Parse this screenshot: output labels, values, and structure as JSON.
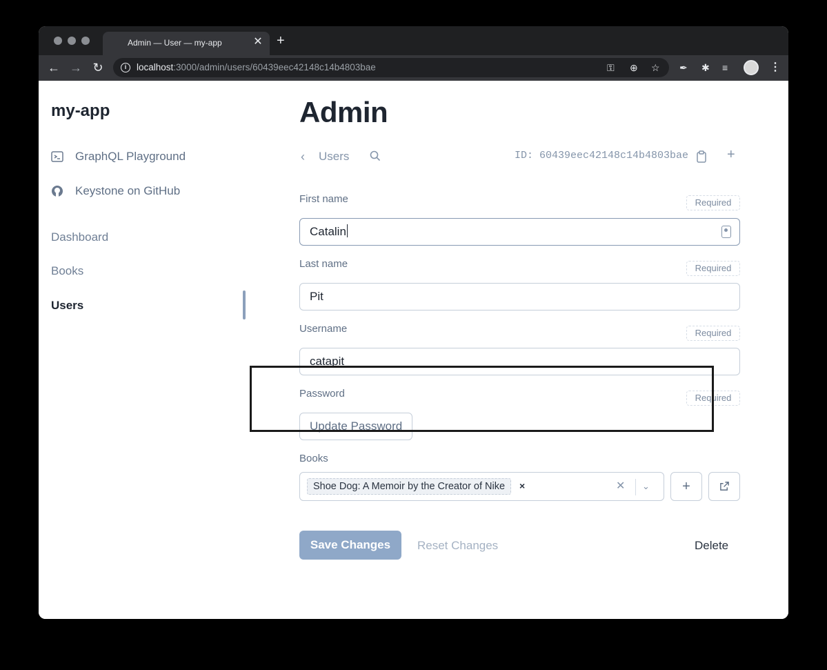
{
  "browser": {
    "tab_title": "Admin — User — my-app",
    "url_host": "localhost",
    "url_path": ":3000/admin/users/60439eec42148c14b4803bae"
  },
  "sidebar": {
    "brand": "my-app",
    "links": [
      {
        "label": "GraphQL Playground",
        "icon": "terminal-icon"
      },
      {
        "label": "Keystone on GitHub",
        "icon": "github-icon"
      }
    ],
    "nav": [
      {
        "label": "Dashboard",
        "active": false
      },
      {
        "label": "Books",
        "active": false
      },
      {
        "label": "Users",
        "active": true
      }
    ]
  },
  "main": {
    "title": "Admin",
    "breadcrumb": "Users",
    "id_label": "ID: 60439eec42148c14b4803bae",
    "fields": {
      "first_name": {
        "label": "First name",
        "value": "Catalin",
        "required": "Required"
      },
      "last_name": {
        "label": "Last name",
        "value": "Pit",
        "required": "Required"
      },
      "username": {
        "label": "Username",
        "value": "catapit",
        "required": "Required"
      },
      "password": {
        "label": "Password",
        "button": "Update Password",
        "required": "Required"
      },
      "books": {
        "label": "Books",
        "selected": "Shoe Dog: A Memoir by the Creator of Nike"
      }
    },
    "actions": {
      "save": "Save Changes",
      "reset": "Reset Changes",
      "delete": "Delete"
    }
  },
  "colors": {
    "accent": "#8fa8c8",
    "text_dark": "#1e2530",
    "text_muted": "#5f6f85"
  }
}
